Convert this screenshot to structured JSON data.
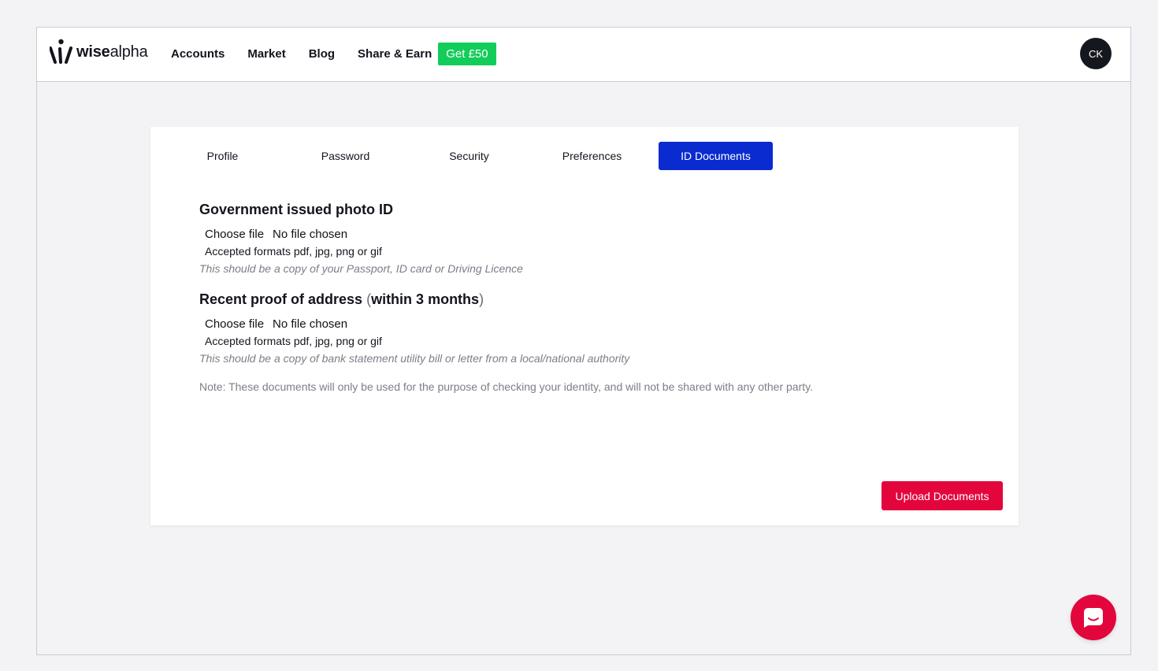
{
  "header": {
    "logo_bold": "wise",
    "logo_light": "alpha",
    "nav": [
      "Accounts",
      "Market",
      "Blog",
      "Share & Earn"
    ],
    "badge": "Get £50",
    "avatar_initials": "CK"
  },
  "tabs": [
    "Profile",
    "Password",
    "Security",
    "Preferences",
    "ID Documents"
  ],
  "active_tab": "ID Documents",
  "sections": [
    {
      "title": "Government issued photo ID",
      "file_button": "Choose file",
      "file_status": "No file chosen",
      "formats": "Accepted formats pdf, jpg, png or gif",
      "hint": "This should be a copy of your Passport, ID card or Driving Licence"
    },
    {
      "title": "Recent proof of address",
      "title_paren_open": "(",
      "title_paren_text": "within 3 months",
      "title_paren_close": ")",
      "file_button": "Choose file",
      "file_status": "No file chosen",
      "formats": "Accepted formats pdf, jpg, png or gif",
      "hint": "This should be a copy of bank statement utility bill or letter from a local/national authority"
    }
  ],
  "note": "Note: These documents will only be used for the purpose of checking your identity, and will not be shared with any other party.",
  "upload_button": "Upload Documents",
  "colors": {
    "brand_blue": "#0a2bd0",
    "accent_red": "#e3063c",
    "badge_green": "#12cd5a"
  }
}
